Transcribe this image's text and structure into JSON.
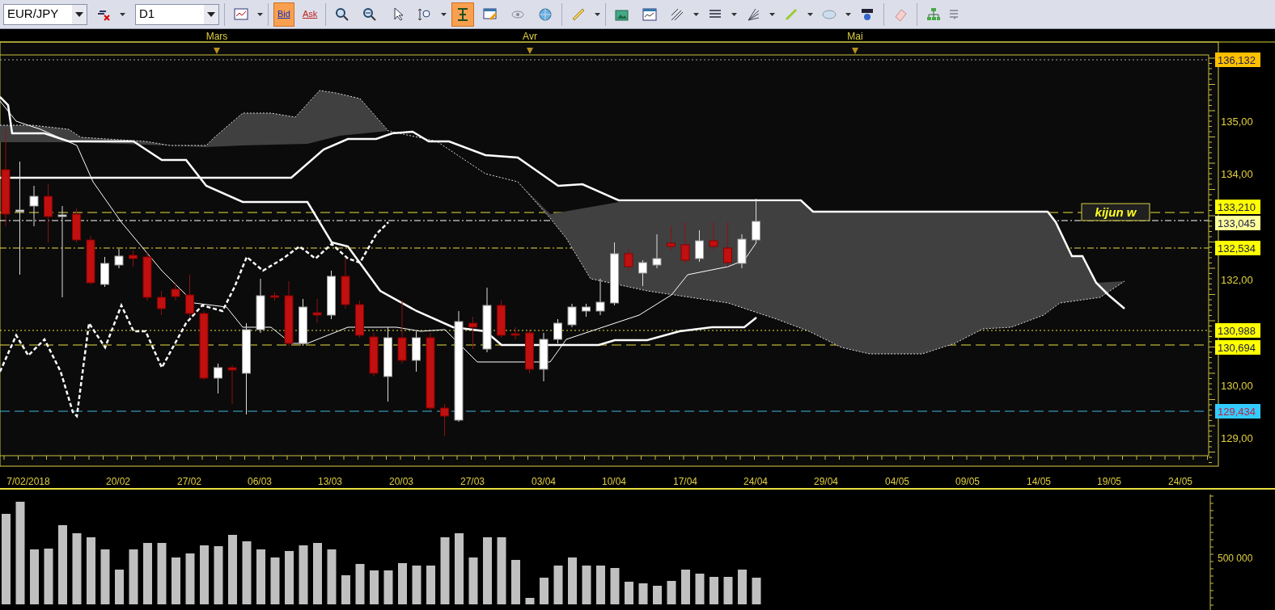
{
  "toolbar": {
    "symbol": "EUR/JPY",
    "timeframe": "D1",
    "quote_buttons": [
      {
        "label": "Bid",
        "selected": true
      },
      {
        "label": "Ask",
        "selected": false
      }
    ],
    "crosshair_tool": {
      "selected": true
    }
  },
  "chart": {
    "months": [
      "Mars",
      "Avr",
      "Mai"
    ],
    "price_ticks": [
      "135,00",
      "134,00",
      "132,00",
      "130,00",
      "129,00"
    ],
    "price_markers": [
      {
        "value": "136,132",
        "color": "#ffc000"
      },
      {
        "value": "133,210",
        "color": "#ffff00"
      },
      {
        "value": "133,045",
        "color": "#ffff99"
      },
      {
        "value": "132,534",
        "color": "#ffff00"
      },
      {
        "value": "130,988",
        "color": "#ffff00"
      },
      {
        "value": "130,694",
        "color": "#ffff00"
      },
      {
        "value": "129,434",
        "color": "#33ccff"
      }
    ],
    "annotation": "kijun w",
    "dates": [
      "7/02/2018",
      "20/02",
      "27/02",
      "06/03",
      "13/03",
      "20/03",
      "27/03",
      "03/04",
      "10/04",
      "17/04",
      "24/04",
      "29/04",
      "04/05",
      "09/05",
      "14/05",
      "19/05",
      "24/05"
    ]
  },
  "volume": {
    "ticks": [
      "500 000"
    ]
  }
}
